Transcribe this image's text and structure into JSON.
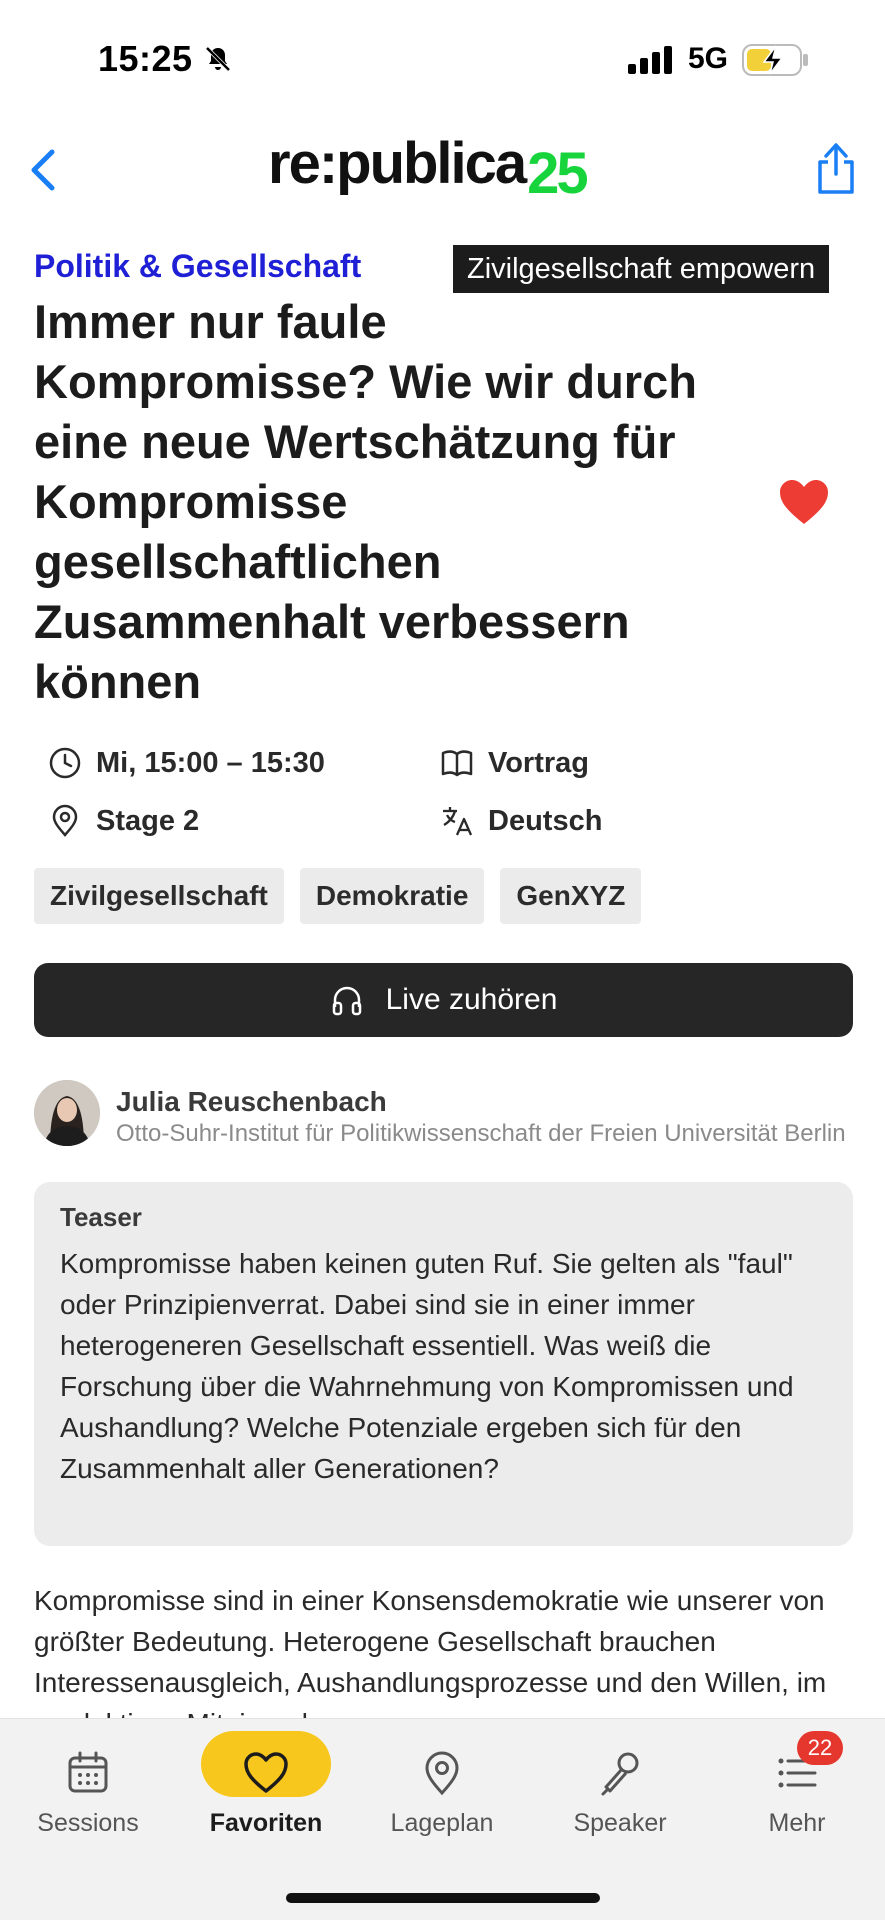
{
  "status_bar": {
    "time": "15:25",
    "network": "5G"
  },
  "header": {
    "logo_text": "re:publica",
    "logo_number": "25",
    "accent_color": "#18d43c"
  },
  "session": {
    "track": "Politik & Gesellschaft",
    "topic": "Zivilgesellschaft empowern",
    "title": "Immer nur faule Kompromisse? Wie wir durch eine neue Wertschätzung für Kompromisse gesellschaftlichen Zusammenhalt verbessern können",
    "time": "Mi, 15:00 – 15:30",
    "stage": "Stage 2",
    "format": "Vortrag",
    "language": "Deutsch",
    "tags": [
      "Zivilgesellschaft",
      "Demokratie",
      "GenXYZ"
    ],
    "live_button": "Live zuhören",
    "favorite_color": "#ec3c34"
  },
  "speaker": {
    "name": "Julia Reuschenbach",
    "organization": "Otto-Suhr-Institut für Politikwissenschaft der Freien Universität Berlin"
  },
  "teaser": {
    "label": "Teaser",
    "text": "Kompromisse haben keinen guten Ruf. Sie gelten als \"faul\" oder Prinzipienverrat. Dabei sind sie in einer immer heterogeneren Gesellschaft essentiell. Was weiß die Forschung über die Wahrnehmung von Kompromissen und Aushandlung? Welche Potenziale ergeben sich für den Zusammenhalt aller Generationen?"
  },
  "description": "Kompromisse sind in einer Konsensdemokratie wie unserer von größter Bedeutung. Heterogene Gesellschaft brauchen Interessenausgleich, Aushandlungsprozesse und den Willen, im produktiven Miteinander",
  "tabbar": {
    "tabs": [
      {
        "label": "Sessions",
        "icon": "calendar-icon"
      },
      {
        "label": "Favoriten",
        "icon": "heart-icon"
      },
      {
        "label": "Lageplan",
        "icon": "location-pin-icon"
      },
      {
        "label": "Speaker",
        "icon": "microphone-icon"
      },
      {
        "label": "Mehr",
        "icon": "list-icon"
      }
    ],
    "active": "Favoriten",
    "active_color": "#f7c71e",
    "badge_count": "22"
  }
}
